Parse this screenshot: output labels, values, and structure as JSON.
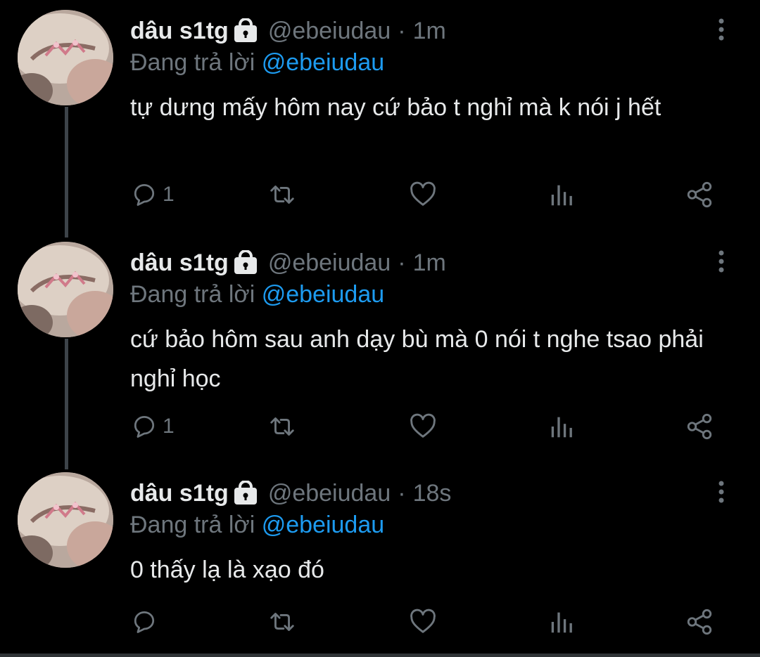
{
  "tweets": [
    {
      "name": "dâu s1tg",
      "handle": "@ebeiudau",
      "separator": "·",
      "time": "1m",
      "replying_prefix": "Đang trả lời",
      "replying_to": "@ebeiudau",
      "text": "tự dưng mấy hôm nay cứ bảo t nghỉ mà k nói j hết",
      "reply_count": "1"
    },
    {
      "name": "dâu s1tg",
      "handle": "@ebeiudau",
      "separator": "·",
      "time": "1m",
      "replying_prefix": "Đang trả lời",
      "replying_to": "@ebeiudau",
      "text": "cứ bảo hôm sau anh dạy bù mà 0 nói t nghe tsao phải nghỉ học",
      "reply_count": "1"
    },
    {
      "name": "dâu s1tg",
      "handle": "@ebeiudau",
      "separator": "·",
      "time": "18s",
      "replying_prefix": "Đang trả lời",
      "replying_to": "@ebeiudau",
      "text": "0 thấy lạ là xạo đó",
      "reply_count": ""
    }
  ],
  "icons": {
    "lock": "lock-icon",
    "more": "more-vertical-icon",
    "reply": "reply-icon",
    "retweet": "retweet-icon",
    "like": "heart-icon",
    "analytics": "analytics-icon",
    "share": "share-icon"
  },
  "colors": {
    "background": "#000000",
    "name": "#e7e9ea",
    "muted": "#6e767d",
    "mention": "#1d9bf0",
    "thread_line": "#3d4349"
  }
}
